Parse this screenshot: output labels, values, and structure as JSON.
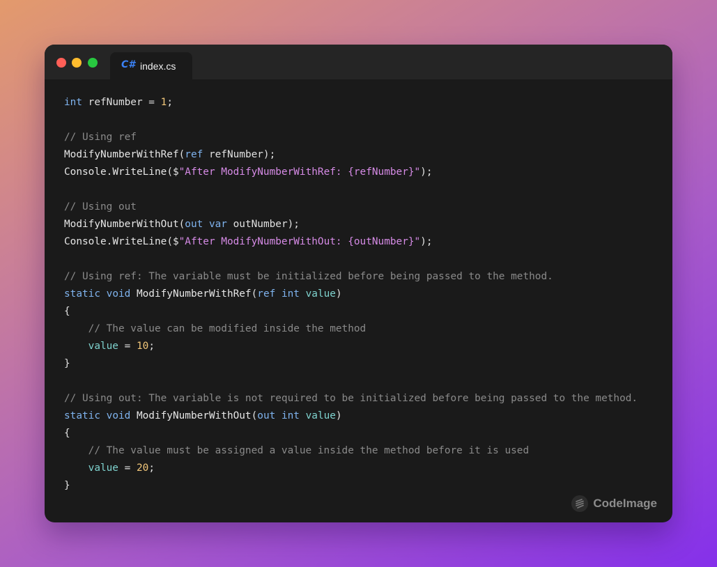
{
  "window": {
    "tab": {
      "icon": "C#",
      "filename": "index.cs"
    },
    "traffic_lights": {
      "close": "#ff5f57",
      "minimize": "#febc2e",
      "maximize": "#28c840"
    }
  },
  "code": {
    "language": "csharp",
    "lines": [
      [
        [
          "kw",
          "int"
        ],
        [
          "plain",
          " refNumber = "
        ],
        [
          "num",
          "1"
        ],
        [
          "plain",
          ";"
        ]
      ],
      [],
      [
        [
          "comment",
          "// Using ref"
        ]
      ],
      [
        [
          "fn",
          "ModifyNumberWithRef"
        ],
        [
          "plain",
          "("
        ],
        [
          "kw",
          "ref"
        ],
        [
          "plain",
          " refNumber);"
        ]
      ],
      [
        [
          "fn",
          "Console"
        ],
        [
          "plain",
          "."
        ],
        [
          "fn",
          "WriteLine"
        ],
        [
          "plain",
          "($"
        ],
        [
          "str",
          "\"After ModifyNumberWithRef: {refNumber}\""
        ],
        [
          "plain",
          ");"
        ]
      ],
      [],
      [
        [
          "comment",
          "// Using out"
        ]
      ],
      [
        [
          "fn",
          "ModifyNumberWithOut"
        ],
        [
          "plain",
          "("
        ],
        [
          "kw",
          "out"
        ],
        [
          "plain",
          " "
        ],
        [
          "kw",
          "var"
        ],
        [
          "plain",
          " outNumber);"
        ]
      ],
      [
        [
          "fn",
          "Console"
        ],
        [
          "plain",
          "."
        ],
        [
          "fn",
          "WriteLine"
        ],
        [
          "plain",
          "($"
        ],
        [
          "str",
          "\"After ModifyNumberWithOut: {outNumber}\""
        ],
        [
          "plain",
          ");"
        ]
      ],
      [],
      [
        [
          "comment",
          "// Using ref: The variable must be initialized before being passed to the method."
        ]
      ],
      [
        [
          "kw",
          "static"
        ],
        [
          "plain",
          " "
        ],
        [
          "kw",
          "void"
        ],
        [
          "plain",
          " "
        ],
        [
          "fn",
          "ModifyNumberWithRef"
        ],
        [
          "plain",
          "("
        ],
        [
          "kw",
          "ref"
        ],
        [
          "plain",
          " "
        ],
        [
          "kw",
          "int"
        ],
        [
          "plain",
          " "
        ],
        [
          "var",
          "value"
        ],
        [
          "plain",
          ")"
        ]
      ],
      [
        [
          "plain",
          "{"
        ]
      ],
      [
        [
          "plain",
          "    "
        ],
        [
          "comment",
          "// The value can be modified inside the method"
        ]
      ],
      [
        [
          "plain",
          "    "
        ],
        [
          "var",
          "value"
        ],
        [
          "plain",
          " = "
        ],
        [
          "num",
          "10"
        ],
        [
          "plain",
          ";"
        ]
      ],
      [
        [
          "plain",
          "}"
        ]
      ],
      [],
      [
        [
          "comment",
          "// Using out: The variable is not required to be initialized before being passed to the method."
        ]
      ],
      [
        [
          "kw",
          "static"
        ],
        [
          "plain",
          " "
        ],
        [
          "kw",
          "void"
        ],
        [
          "plain",
          " "
        ],
        [
          "fn",
          "ModifyNumberWithOut"
        ],
        [
          "plain",
          "("
        ],
        [
          "kw",
          "out"
        ],
        [
          "plain",
          " "
        ],
        [
          "kw",
          "int"
        ],
        [
          "plain",
          " "
        ],
        [
          "var",
          "value"
        ],
        [
          "plain",
          ")"
        ]
      ],
      [
        [
          "plain",
          "{"
        ]
      ],
      [
        [
          "plain",
          "    "
        ],
        [
          "comment",
          "// The value must be assigned a value inside the method before it is used"
        ]
      ],
      [
        [
          "plain",
          "    "
        ],
        [
          "var",
          "value"
        ],
        [
          "plain",
          " = "
        ],
        [
          "num",
          "20"
        ],
        [
          "plain",
          ";"
        ]
      ],
      [
        [
          "plain",
          "}"
        ]
      ]
    ]
  },
  "colors": {
    "keyword": "#7fb3ee",
    "number": "#f2c77a",
    "comment": "#8a8a8a",
    "string": "#d68be6",
    "variable": "#7fd3cf",
    "window_bg": "#1a1a1a",
    "titlebar_bg": "#252525"
  },
  "branding": {
    "icon": "codeimage-logo-icon",
    "label": "CodeImage"
  }
}
